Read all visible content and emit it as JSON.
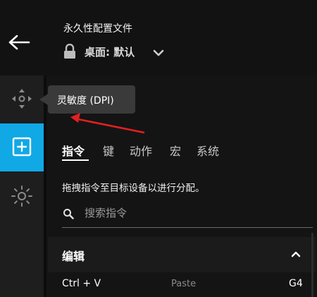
{
  "header": {
    "profile_title": "永久性配置文件",
    "profile_select": "桌面: 默认",
    "icons": [
      "back-arrow-icon",
      "lock-icon",
      "chevron-down-icon"
    ]
  },
  "rail": {
    "items": [
      {
        "name": "dpi",
        "icon": "dpi-move-icon",
        "active": false
      },
      {
        "name": "assign",
        "icon": "plus-square-icon",
        "active": true
      },
      {
        "name": "lighting",
        "icon": "sun-icon",
        "active": false
      }
    ]
  },
  "tooltip": {
    "text": "灵敏度 (DPI)"
  },
  "tabs": [
    {
      "label": "指令",
      "active": true
    },
    {
      "label": "键",
      "active": false
    },
    {
      "label": "动作",
      "active": false
    },
    {
      "label": "宏",
      "active": false
    },
    {
      "label": "系统",
      "active": false
    }
  ],
  "hint": "拖拽指令至目标设备以进行分配。",
  "search": {
    "placeholder": "搜索指令",
    "value": ""
  },
  "section": {
    "title": "编辑",
    "expanded": true
  },
  "commands": [
    {
      "shortcut": "Ctrl + V",
      "description": "Paste",
      "binding": "G4"
    }
  ],
  "colors": {
    "accent": "#10a9e6",
    "background": "#121212",
    "annotation_arrow": "#e02020"
  }
}
